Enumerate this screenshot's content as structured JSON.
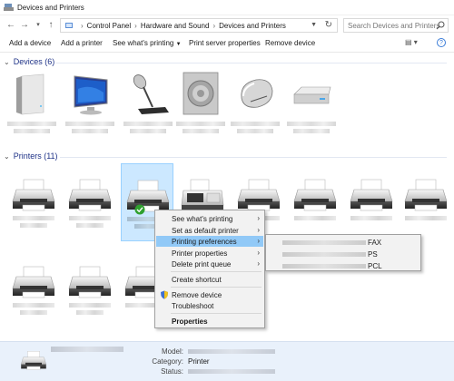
{
  "window": {
    "title": "Devices and Printers"
  },
  "nav": {
    "breadcrumbs": [
      "Control Panel",
      "Hardware and Sound",
      "Devices and Printers"
    ],
    "search_placeholder": "Search Devices and Printers"
  },
  "toolbar": {
    "add_device": "Add a device",
    "add_printer": "Add a printer",
    "whats_printing": "See what's printing",
    "print_server": "Print server properties",
    "remove_device": "Remove device"
  },
  "devices": {
    "header": "Devices (6)"
  },
  "printers": {
    "header": "Printers (11)"
  },
  "context_menu": {
    "items": [
      "See what's printing",
      "Set as default printer",
      "Printing preferences",
      "Printer properties",
      "Delete print queue",
      "Create shortcut",
      "Remove device",
      "Troubleshoot",
      "Properties"
    ]
  },
  "submenu": {
    "suffixes": [
      "FAX",
      "PS",
      "PCL"
    ]
  },
  "details": {
    "model_label": "Model:",
    "category_label": "Category:",
    "category_value": "Printer",
    "status_label": "Status:"
  },
  "colors": {
    "accent": "#1e3287",
    "selection": "#cce8ff",
    "menu_highlight": "#91c9f7",
    "status_ok": "#2fa02f"
  }
}
